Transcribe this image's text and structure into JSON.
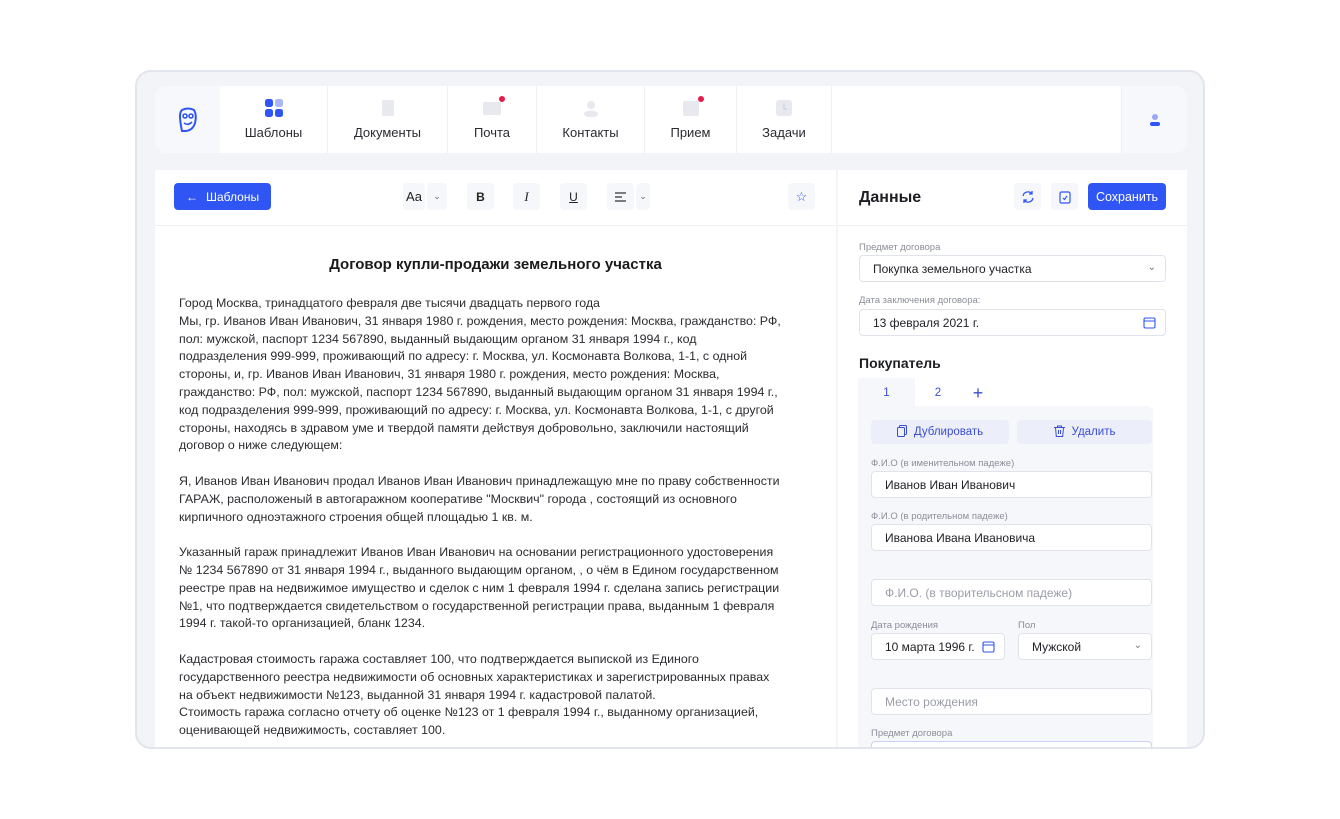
{
  "nav": {
    "tabs": [
      {
        "label": "Шаблоны",
        "icon": "grid-icon",
        "active": true
      },
      {
        "label": "Документы",
        "icon": "document-icon"
      },
      {
        "label": "Почта",
        "icon": "mail-icon",
        "badge": true
      },
      {
        "label": "Контакты",
        "icon": "contacts-icon"
      },
      {
        "label": "Прием",
        "icon": "calendar-icon",
        "badge": true
      },
      {
        "label": "Задачи",
        "icon": "clock-icon"
      }
    ]
  },
  "toolbar": {
    "back_label": "Шаблоны",
    "font_label": "Aa",
    "bold": "B",
    "italic": "I",
    "underline": "U"
  },
  "document": {
    "title": "Договор купли-продажи земельного участка",
    "paragraphs": [
      [
        "Город Москва, тринадцатого февраля две тысячи двадцать первого года",
        "Мы, гр. Иванов Иван Иванович, 31 января 1980 г. рождения, место рождения: Москва, гражданство: РФ,",
        "пол: мужской, паспорт 1234 567890, выданный выдающим органом 31 января 1994 г., код",
        "подразделения 999-999, проживающий по адресу: г. Москва, ул. Космонавта Волкова, 1-1, с одной",
        "стороны, и, гр. Иванов Иван Иванович, 31 января 1980 г. рождения, место рождения: Москва,",
        "гражданство: РФ, пол: мужской, паспорт 1234 567890, выданный выдающим органом 31 января 1994 г.,",
        "код подразделения 999-999, проживающий по адресу: г. Москва, ул. Космонавта Волкова, 1-1, с другой",
        "стороны, находясь в здравом уме и твердой памяти действуя добровольно, заключили настоящий",
        "договор о ниже следующем:"
      ],
      [
        "Я, Иванов Иван Иванович продал Иванов Иван Иванович принадлежащую мне по праву собственности",
        "ГАРАЖ, расположеный в автогаражном кооперативе \"Москвич\" города , состоящий из основного",
        "кирпичного одноэтажного строения общей площадью 1 кв. м."
      ],
      [
        "Указанный гараж принадлежит Иванов Иван Иванович на основании регистрационного удостоверения",
        "№ 1234 567890 от 31 января 1994 г., выданного выдающим органом, , о чём в Едином государственном",
        "реестре прав на недвижимое имущество и сделок с ним 1 февраля 1994 г. сделана запись регистрации",
        "№1, что подтверждается свидетельством о государственной регистрации права, выданным 1 февраля",
        "1994 г. такой-то организацией, бланк 1234."
      ],
      [
        "Кадастровая стоимость гаража составляет 100, что подтверждается выпиской из Единого",
        "государственного реестра недвижимости об основных характеристиках и зарегистрированных правах",
        "на объект недвижимости №123, выданной 31 января 1994 г. кадастровой палатой.",
        "Стоимость гаража согласно отчету об оценке №123 от 1 февраля 1994 г., выданному организацией,",
        "оценивающей недвижимость, составляет 100."
      ]
    ]
  },
  "panel": {
    "title": "Данные",
    "save_label": "Сохранить",
    "subject_label": "Предмет договора",
    "subject_value": "Покупка земельного участка",
    "date_label": "Дата заключения договора:",
    "date_value": "13 февраля 2021 г.",
    "buyer_title": "Покупатель",
    "buyer_tabs": [
      "1",
      "2"
    ],
    "add_tab": "+",
    "duplicate_label": "Дублировать",
    "delete_label": "Удалить",
    "fio_nom_label": "Ф.И.О (в именительном падеже)",
    "fio_nom_value": "Иванов Иван Иванович",
    "fio_gen_label": "Ф.И.О (в родительном падеже)",
    "fio_gen_value": "Иванова Ивана Ивановича",
    "fio_ins_placeholder": "Ф.И.О. (в творительсном падеже)",
    "birth_label": "Дата рождения",
    "birth_value": "10 марта 1996 г.",
    "sex_label": "Пол",
    "sex_value": "Мужской",
    "birthplace_placeholder": "Место рождения",
    "subject2_label": "Предмет договора"
  },
  "colors": {
    "accent": "#2f55f5",
    "badge": "#e8194b"
  }
}
